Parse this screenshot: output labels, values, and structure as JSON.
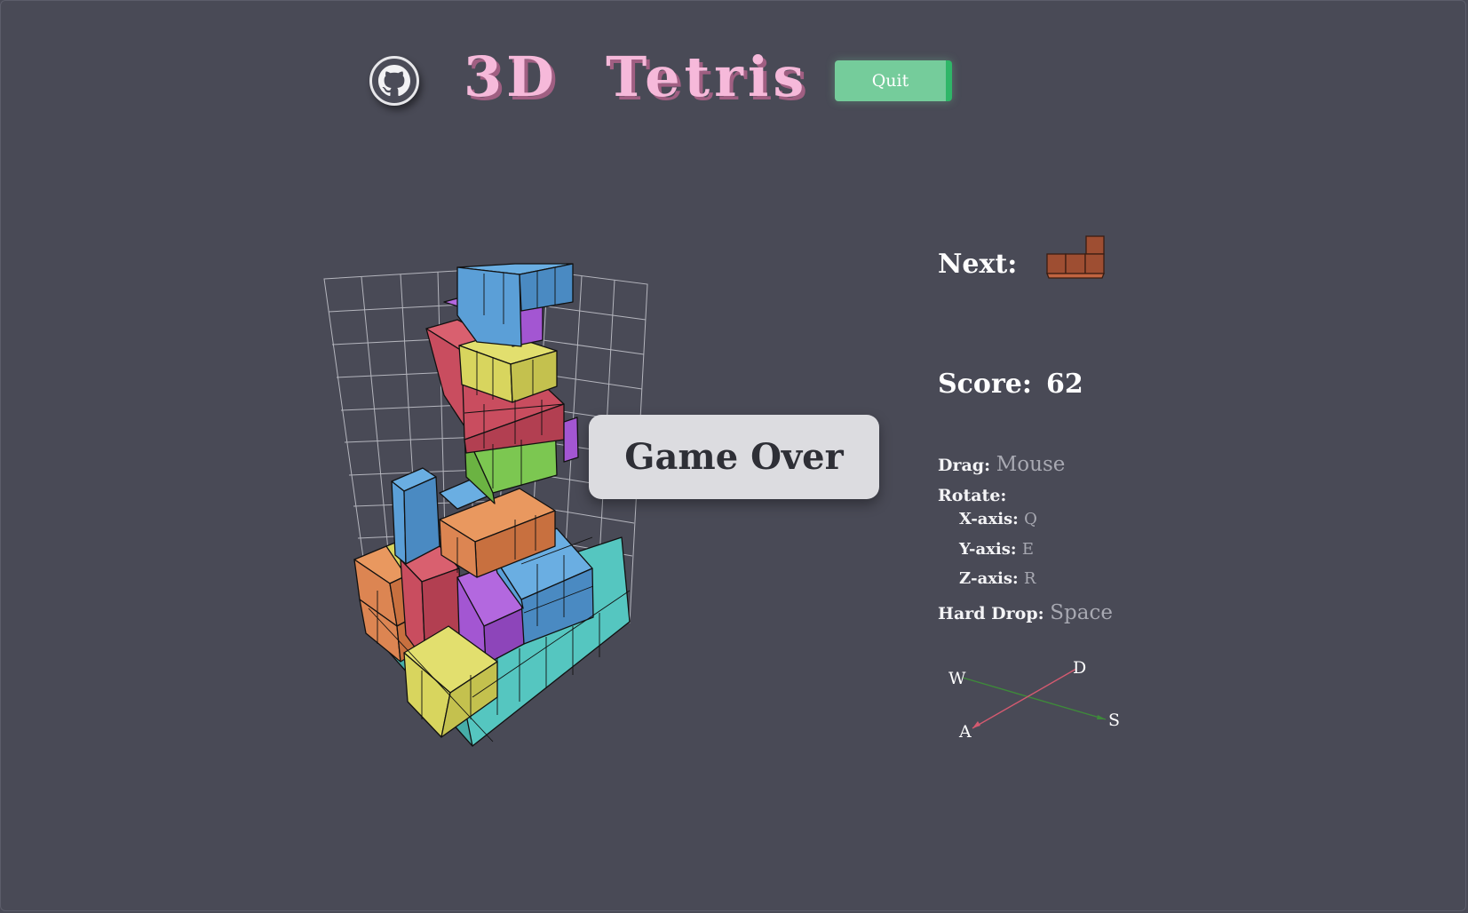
{
  "header": {
    "github_icon": "github-icon",
    "title": "3D  Tetris",
    "quit_label": "Quit"
  },
  "game": {
    "overlay_text": "Game Over",
    "colors": {
      "background": "#494a56",
      "title": "#f6b9da",
      "quit": "#75cc9b",
      "cyan": "#55c6c0",
      "yellow": "#d8d55e",
      "orange": "#dc8552",
      "red": "#c94d5f",
      "blue": "#5b9fd7",
      "purple": "#a356d2",
      "green": "#7cc751",
      "next_piece": "#9e4e32"
    }
  },
  "panel": {
    "next_label": "Next:",
    "score_label": "Score:",
    "score_value": "62",
    "controls": {
      "drag_label": "Drag:",
      "drag_value": "Mouse",
      "rotate_label": "Rotate:",
      "x_label": "X-axis:",
      "x_value": "Q",
      "y_label": "Y-axis:",
      "y_value": "E",
      "z_label": "Z-axis:",
      "z_value": "R",
      "drop_label": "Hard Drop:",
      "drop_value": "Space"
    },
    "axes": {
      "w": "W",
      "a": "A",
      "s": "S",
      "d": "D"
    }
  }
}
